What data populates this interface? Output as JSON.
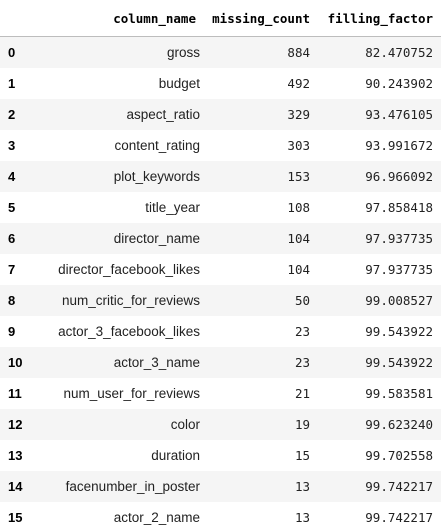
{
  "table": {
    "index_header": "",
    "columns": [
      "column_name",
      "missing_count",
      "filling_factor"
    ],
    "rows": [
      {
        "index": "0",
        "column_name": "gross",
        "missing_count": "884",
        "filling_factor": "82.470752"
      },
      {
        "index": "1",
        "column_name": "budget",
        "missing_count": "492",
        "filling_factor": "90.243902"
      },
      {
        "index": "2",
        "column_name": "aspect_ratio",
        "missing_count": "329",
        "filling_factor": "93.476105"
      },
      {
        "index": "3",
        "column_name": "content_rating",
        "missing_count": "303",
        "filling_factor": "93.991672"
      },
      {
        "index": "4",
        "column_name": "plot_keywords",
        "missing_count": "153",
        "filling_factor": "96.966092"
      },
      {
        "index": "5",
        "column_name": "title_year",
        "missing_count": "108",
        "filling_factor": "97.858418"
      },
      {
        "index": "6",
        "column_name": "director_name",
        "missing_count": "104",
        "filling_factor": "97.937735"
      },
      {
        "index": "7",
        "column_name": "director_facebook_likes",
        "missing_count": "104",
        "filling_factor": "97.937735"
      },
      {
        "index": "8",
        "column_name": "num_critic_for_reviews",
        "missing_count": "50",
        "filling_factor": "99.008527"
      },
      {
        "index": "9",
        "column_name": "actor_3_facebook_likes",
        "missing_count": "23",
        "filling_factor": "99.543922"
      },
      {
        "index": "10",
        "column_name": "actor_3_name",
        "missing_count": "23",
        "filling_factor": "99.543922"
      },
      {
        "index": "11",
        "column_name": "num_user_for_reviews",
        "missing_count": "21",
        "filling_factor": "99.583581"
      },
      {
        "index": "12",
        "column_name": "color",
        "missing_count": "19",
        "filling_factor": "99.623240"
      },
      {
        "index": "13",
        "column_name": "duration",
        "missing_count": "15",
        "filling_factor": "99.702558"
      },
      {
        "index": "14",
        "column_name": "facenumber_in_poster",
        "missing_count": "13",
        "filling_factor": "99.742217"
      },
      {
        "index": "15",
        "column_name": "actor_2_name",
        "missing_count": "13",
        "filling_factor": "99.742217"
      }
    ]
  },
  "colors": {
    "row_stripe": "#f5f5f5",
    "row_plain": "#ffffff",
    "header_border": "#bdbdbd",
    "text": "#000000"
  }
}
